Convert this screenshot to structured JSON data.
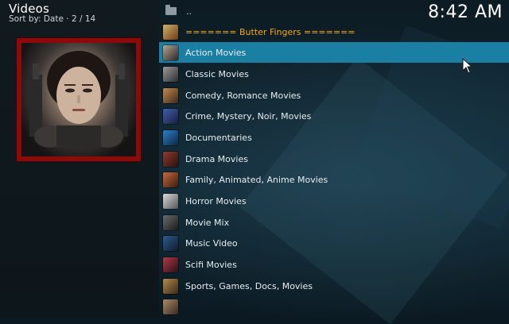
{
  "header": {
    "title": "Videos",
    "sort": "Sort by: Date",
    "position": "2 / 14"
  },
  "clock": "8:42 AM",
  "list": {
    "parent": "..",
    "section": "======= Butter Fingers =======",
    "items": [
      {
        "label": "Action Movies",
        "selected": true
      },
      {
        "label": "Classic Movies"
      },
      {
        "label": "Comedy, Romance Movies"
      },
      {
        "label": "Crime, Mystery, Noir, Movies"
      },
      {
        "label": "Documentaries"
      },
      {
        "label": "Drama Movies"
      },
      {
        "label": "Family, Animated, Anime Movies"
      },
      {
        "label": "Horror Movies"
      },
      {
        "label": "Movie Mix"
      },
      {
        "label": "Music Video"
      },
      {
        "label": "Scifi Movies"
      },
      {
        "label": "Sports, Games, Docs, Movies"
      }
    ]
  },
  "colors": {
    "selection": "#1a7fa3",
    "section_text": "#f0a81c",
    "poster_frame": "#8c0a0a"
  }
}
